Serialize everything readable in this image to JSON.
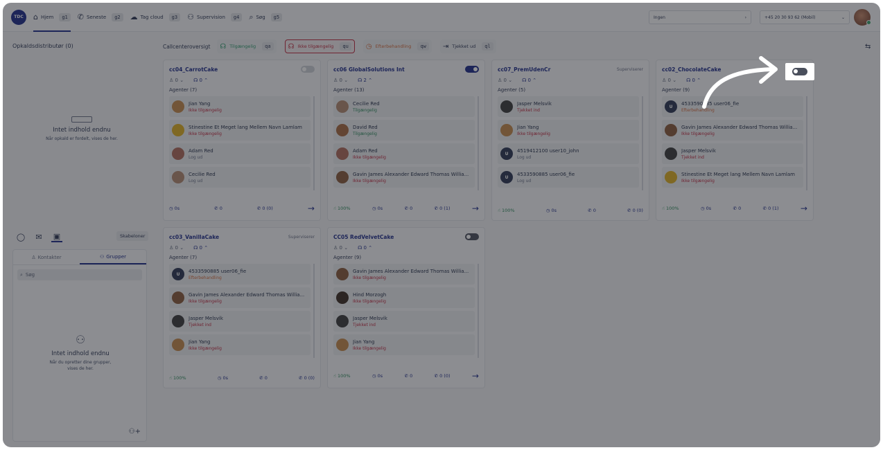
{
  "topbar": {
    "logo": "TDC",
    "nav": [
      {
        "label": "Hjem",
        "icon": "home-icon",
        "glyph": "⌂",
        "key": "g1",
        "active": true
      },
      {
        "label": "Seneste",
        "icon": "phone-icon",
        "glyph": "✆",
        "key": "g2",
        "active": false
      },
      {
        "label": "Tag cloud",
        "icon": "cloud-icon",
        "glyph": "☁",
        "key": "g3",
        "active": false
      },
      {
        "label": "Supervision",
        "icon": "supervision-icon",
        "glyph": "⚇",
        "key": "g4",
        "active": false
      },
      {
        "label": "Søg",
        "icon": "search-icon",
        "glyph": "⌕",
        "key": "g5",
        "active": false
      }
    ],
    "ingen_select": {
      "value": "Ingen",
      "chevron": "›"
    },
    "number_select": {
      "value": "+45 20 30 93 62 (Mobil)",
      "chevron": "⌄"
    }
  },
  "left": {
    "distributor_title": "Opkaldsdistributør (0)",
    "empty1": {
      "title": "Intet indhold endnu",
      "sub": "Når opkald er fordelt, vises de her."
    },
    "templates_button": "Skabeloner",
    "tabs": [
      {
        "label": "Kontakter",
        "glyph": "♙",
        "active": false
      },
      {
        "label": "Grupper",
        "glyph": "⚇",
        "active": true
      }
    ],
    "search_placeholder": "Søg",
    "empty2": {
      "title": "Intet indhold endnu",
      "sub": "Når du opretter dine grupper, vises de her."
    }
  },
  "header": {
    "title": "Callcenteroversigt",
    "statuses": [
      {
        "label": "Tilgængelig",
        "key": "qa",
        "color": "#2a9a6a",
        "glyph": "☊",
        "icon": "headset-icon",
        "highlight": false
      },
      {
        "label": "Ikke tilgængelig",
        "key": "qu",
        "color": "#c0283e",
        "glyph": "☊",
        "icon": "headset-off-icon",
        "highlight": true
      },
      {
        "label": "Efterbehandling",
        "key": "qw",
        "color": "#d76b3a",
        "glyph": "◷",
        "icon": "clock-icon",
        "highlight": false
      },
      {
        "label": "Tjekket ud",
        "key": "ql",
        "color": "#2b3552",
        "glyph": "⇥",
        "icon": "logout-icon",
        "highlight": false
      }
    ]
  },
  "queues": [
    {
      "name": "cc04_CarrotCake",
      "right": "toggle",
      "toggle": "off",
      "counts": {
        "people": "0 ⌄",
        "calls": "0 ⌃"
      },
      "agents_label": "Agenter (7)",
      "agents": [
        {
          "name": "Jian Yang",
          "status": "Ikke tilgængelig",
          "st": "red",
          "av": "#c68a4a"
        },
        {
          "name": "Stinestine Et Meget lang Mellem Navn Lamlam",
          "status": "Ikke tilgængelig",
          "st": "red",
          "av": "#e0b020"
        },
        {
          "name": "Adam Red",
          "status": "Log ud",
          "st": "gray",
          "av": "#b06a5a"
        },
        {
          "name": "Cecilie Red",
          "status": "Log ud",
          "st": "gray",
          "av": "#b58a70"
        }
      ],
      "footer": [
        {
          "t": "◷",
          "v": "0s"
        },
        {
          "t": "✆",
          "v": "0"
        },
        {
          "t": "✆",
          "v": "0 (0)"
        }
      ],
      "show_pct": false,
      "arrow": true
    },
    {
      "name": "cc06 GlobalSolutions Int",
      "right": "toggle",
      "toggle": "on",
      "counts": {
        "people": "0 ⌄",
        "calls": "2 ⌃"
      },
      "agents_label": "Agenter (13)",
      "agents": [
        {
          "name": "Cecilie Red",
          "status": "Tilgængelig",
          "st": "green",
          "av": "#b58a70"
        },
        {
          "name": "David Red",
          "status": "Tilgængelig",
          "st": "green",
          "av": "#a86a40"
        },
        {
          "name": "Adam Red",
          "status": "Ikke tilgængelig",
          "st": "red",
          "av": "#b06a5a"
        },
        {
          "name": "Gavin James Alexander Edward Thomas Willia...",
          "status": "Ikke tilgængelig",
          "st": "red",
          "av": "#8a5a3a"
        }
      ],
      "footer": [
        {
          "t": "◷",
          "v": "0s"
        },
        {
          "t": "✆",
          "v": "0"
        },
        {
          "t": "✆",
          "v": "0 (1)"
        }
      ],
      "show_pct": true,
      "pct": "100%",
      "arrow": true
    },
    {
      "name": "cc07_PremUdenCr",
      "right": "text",
      "right_text": "Superviserer",
      "counts": {
        "people": "0 ⌄",
        "calls": "0 ⌃"
      },
      "agents_label": "Agenter (5)",
      "agents": [
        {
          "name": "Jasper Melsvik",
          "status": "Tjekket ind",
          "st": "red",
          "av": "#3a3a3a"
        },
        {
          "name": "Jian Yang",
          "status": "Ikke tilgængelig",
          "st": "red",
          "av": "#c68a4a"
        },
        {
          "name": "4519412100 user10_john",
          "status": "Log ud",
          "st": "gray",
          "av": "#2b3552",
          "letter": "U"
        },
        {
          "name": "4533590885 user06_fie",
          "status": "Log ud",
          "st": "gray",
          "av": "#2b3552",
          "letter": "U"
        }
      ],
      "footer": [
        {
          "t": "◷",
          "v": "0s"
        },
        {
          "t": "✆",
          "v": "0"
        },
        {
          "t": "✆",
          "v": "0 (0)"
        }
      ],
      "show_pct": true,
      "pct": "100%",
      "arrow": false
    },
    {
      "name": "cc02_ChocolateCake",
      "right": "none",
      "counts": {
        "people": "0 ⌄",
        "calls": "0 ⌃"
      },
      "agents_label": "Agenter (9)",
      "agents": [
        {
          "name": "4533590885 user06_fie",
          "status": "Efterbehandling",
          "st": "orange",
          "av": "#2b3552",
          "letter": "U"
        },
        {
          "name": "Gavin James Alexander Edward Thomas Willia...",
          "status": "Ikke tilgængelig",
          "st": "red",
          "av": "#8a5a3a"
        },
        {
          "name": "Jasper Melsvik",
          "status": "Tjekket ind",
          "st": "red",
          "av": "#3a3a3a"
        },
        {
          "name": "Stinestine Et Meget lang Mellem Navn Lamlam",
          "status": "Ikke tilgængelig",
          "st": "red",
          "av": "#e0b020"
        }
      ],
      "footer": [
        {
          "t": "◷",
          "v": "0s"
        },
        {
          "t": "✆",
          "v": "0"
        },
        {
          "t": "✆",
          "v": "0 (1)"
        }
      ],
      "show_pct": true,
      "pct": "100%",
      "arrow": true
    },
    {
      "name": "cc03_VanillaCake",
      "right": "text",
      "right_text": "Superviserer",
      "counts": {
        "people": "0 ⌄",
        "calls": "0 ⌃"
      },
      "agents_label": "Agenter (7)",
      "agents": [
        {
          "name": "4533590885 user06_fie",
          "status": "Efterbehandling",
          "st": "orange",
          "av": "#2b3552",
          "letter": "U"
        },
        {
          "name": "Gavin James Alexander Edward Thomas Willia...",
          "status": "Ikke tilgængelig",
          "st": "red",
          "av": "#8a5a3a"
        },
        {
          "name": "Jasper Melsvik",
          "status": "Tjekket ind",
          "st": "red",
          "av": "#3a3a3a"
        },
        {
          "name": "Jian Yang",
          "status": "Ikke tilgængelig",
          "st": "red",
          "av": "#c68a4a"
        }
      ],
      "footer": [
        {
          "t": "◷",
          "v": "0s"
        },
        {
          "t": "✆",
          "v": "0"
        },
        {
          "t": "✆",
          "v": "0 (0)"
        }
      ],
      "show_pct": true,
      "pct": "100%",
      "arrow": false
    },
    {
      "name": "CC05 RedVelvetCake",
      "right": "toggle",
      "toggle": "dark",
      "counts": {
        "people": "0 ⌄",
        "calls": "0 ⌃"
      },
      "agents_label": "Agenter (9)",
      "agents": [
        {
          "name": "Gavin James Alexander Edward Thomas Willia...",
          "status": "Ikke tilgængelig",
          "st": "red",
          "av": "#8a5a3a"
        },
        {
          "name": "Hind Morzogh",
          "status": "Ikke tilgængelig",
          "st": "red",
          "av": "#3a2a20"
        },
        {
          "name": "Jasper Melsvik",
          "status": "Tjekket ind",
          "st": "red",
          "av": "#3a3a3a"
        },
        {
          "name": "Jian Yang",
          "status": "Ikke tilgængelig",
          "st": "red",
          "av": "#c68a4a"
        }
      ],
      "footer": [
        {
          "t": "◷",
          "v": "0s"
        },
        {
          "t": "✆",
          "v": "0"
        },
        {
          "t": "✆",
          "v": "0 (0)"
        }
      ],
      "show_pct": true,
      "pct": "100%",
      "arrow": true
    }
  ]
}
